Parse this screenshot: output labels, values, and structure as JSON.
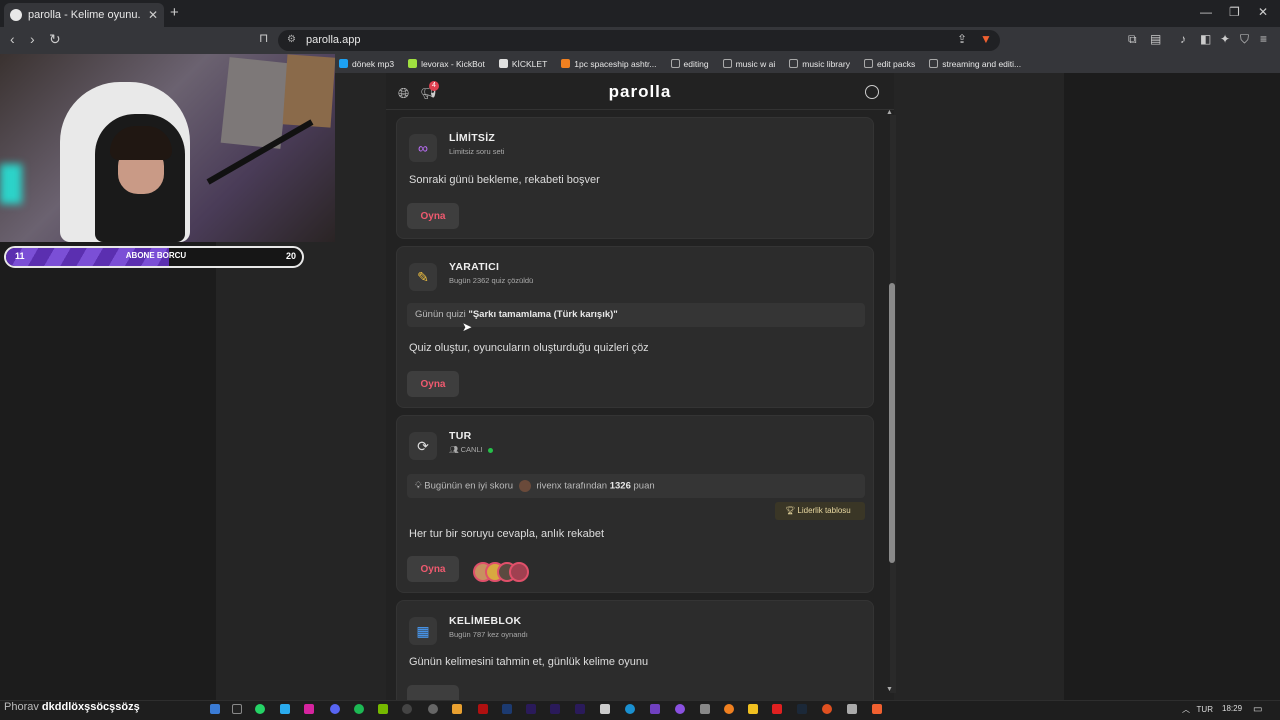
{
  "browser": {
    "tab_title": "parolla - Kelime oyunu. Günlük k",
    "url": "parolla.app",
    "bookmarks": [
      "dönek mp3",
      "levorax - KickBot",
      "KİCKLET",
      "1pc spaceship ashtr...",
      "editing",
      "music w ai",
      "music library",
      "edit packs",
      "streaming and editi..."
    ],
    "bookmark_colors": [
      "#1da1f2",
      "#a0e040",
      "#e0e0e0",
      "#f08020",
      "#888888",
      "#888888",
      "#888888",
      "#888888",
      "#888888"
    ]
  },
  "overlay": {
    "sub_left": "11",
    "sub_label": "ABONE BORCU",
    "sub_right": "20",
    "sub_progress": 0.55
  },
  "header": {
    "logo": "parolla",
    "notification_count": "4"
  },
  "cards": {
    "limitsiz": {
      "title": "LİMİTSİZ",
      "subtitle": "Limitsiz soru seti",
      "description": "Sonraki günü bekleme, rekabeti boşver",
      "play": "Oyna",
      "icon": "infinity-icon"
    },
    "yaratici": {
      "title": "YARATICI",
      "subtitle": "Bugün 2362 quiz çözüldü",
      "quiz_prefix": "Günün quizi",
      "quiz_name": "\"Şarkı tamamlama (Türk karışık)\"",
      "description": "Quiz oluştur, oyuncuların oluşturduğu quizleri çöz",
      "play": "Oyna",
      "icon": "pencil-icon"
    },
    "tur": {
      "title": "TUR",
      "subtitle": "CANLI",
      "best_prefix": "Bugünün en iyi skoru",
      "best_user": "rivenx",
      "best_mid": "tarafından",
      "best_score": "1326",
      "best_suffix": "puan",
      "leaderboard": "Liderlik tablosu",
      "description": "Her tur bir soruyu cevapla, anlık rekabet",
      "play": "Oyna",
      "icon": "refresh-icon"
    },
    "kelimeblok": {
      "title": "KELİMEBLOK",
      "subtitle": "Bugün 787 kez oynandı",
      "description": "Günün kelimesini tahmin et, günlük kelime oyunu",
      "icon": "grid-icon"
    }
  },
  "taskbar": {
    "ticker_prefix": "Phorav",
    "ticker_text": "dkddlöxşsöcşsözş",
    "language": "TUR",
    "time": "18:29"
  }
}
